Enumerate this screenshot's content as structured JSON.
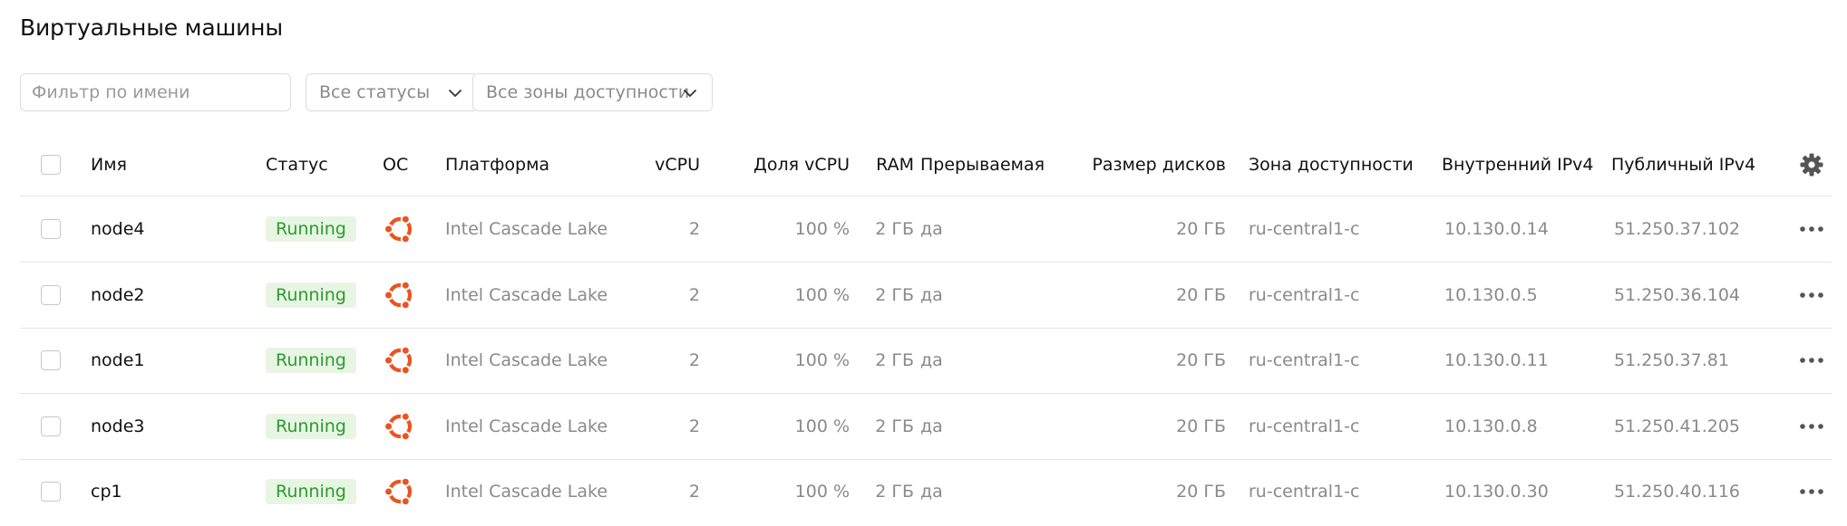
{
  "page": {
    "title": "Виртуальные машины"
  },
  "filters": {
    "name_placeholder": "Фильтр по имени",
    "status_select": "Все статусы",
    "zone_select": "Все зоны доступности"
  },
  "table": {
    "headers": {
      "name": "Имя",
      "status": "Статус",
      "os": "ОС",
      "platform": "Платформа",
      "vcpu": "vCPU",
      "vcpu_share": "Доля vCPU",
      "ram": "RAM",
      "preemptible": "Прерываемая",
      "disk_size": "Размер дисков",
      "zone": "Зона доступности",
      "internal_ipv4": "Внутренний IPv4",
      "public_ipv4": "Публичный IPv4"
    },
    "rows": [
      {
        "name": "node4",
        "status": "Running",
        "os_icon": "ubuntu-icon",
        "platform": "Intel Cascade Lake",
        "vcpu": "2",
        "vcpu_share": "100 %",
        "ram": "2 ГБ",
        "preemptible": "да",
        "disk_size": "20 ГБ",
        "zone": "ru-central1-c",
        "internal_ipv4": "10.130.0.14",
        "public_ipv4": "51.250.37.102"
      },
      {
        "name": "node2",
        "status": "Running",
        "os_icon": "ubuntu-icon",
        "platform": "Intel Cascade Lake",
        "vcpu": "2",
        "vcpu_share": "100 %",
        "ram": "2 ГБ",
        "preemptible": "да",
        "disk_size": "20 ГБ",
        "zone": "ru-central1-c",
        "internal_ipv4": "10.130.0.5",
        "public_ipv4": "51.250.36.104"
      },
      {
        "name": "node1",
        "status": "Running",
        "os_icon": "ubuntu-icon",
        "platform": "Intel Cascade Lake",
        "vcpu": "2",
        "vcpu_share": "100 %",
        "ram": "2 ГБ",
        "preemptible": "да",
        "disk_size": "20 ГБ",
        "zone": "ru-central1-c",
        "internal_ipv4": "10.130.0.11",
        "public_ipv4": "51.250.37.81"
      },
      {
        "name": "node3",
        "status": "Running",
        "os_icon": "ubuntu-icon",
        "platform": "Intel Cascade Lake",
        "vcpu": "2",
        "vcpu_share": "100 %",
        "ram": "2 ГБ",
        "preemptible": "да",
        "disk_size": "20 ГБ",
        "zone": "ru-central1-c",
        "internal_ipv4": "10.130.0.8",
        "public_ipv4": "51.250.41.205"
      },
      {
        "name": "cp1",
        "status": "Running",
        "os_icon": "ubuntu-icon",
        "platform": "Intel Cascade Lake",
        "vcpu": "2",
        "vcpu_share": "100 %",
        "ram": "2 ГБ",
        "preemptible": "да",
        "disk_size": "20 ГБ",
        "zone": "ru-central1-c",
        "internal_ipv4": "10.130.0.30",
        "public_ipv4": "51.250.40.116"
      }
    ]
  },
  "colors": {
    "running_text": "#2d9b2f",
    "running_bg": "#e7f5e3",
    "ubuntu_orange": "#e95420",
    "muted_text": "#8a8a8a",
    "border": "#e5e5e5"
  },
  "icons": {
    "caret": "chevron-down-icon",
    "settings": "gear-icon",
    "row_actions": "more-horizontal-icon",
    "os": "ubuntu-icon"
  }
}
